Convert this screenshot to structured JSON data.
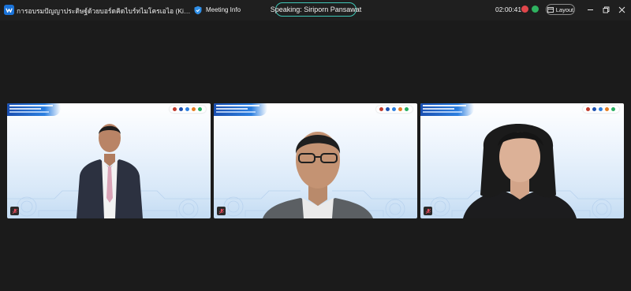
{
  "window": {
    "title": "การอบรมปัญญาประดิษฐ์ด้วยบอร์ดคิดไบร์ทไมโครเอไอ (KidBright μAI) ระหว่างวัน...",
    "meeting_info_label": "Meeting Info",
    "speaking_label": "Speaking: Siriporn Pansawat",
    "timer": "02:00:41",
    "layout_label": "Layout"
  },
  "colors": {
    "background": "#1b1b1b",
    "speaking_border": "#3fc6b6",
    "status_red": "#e0464b",
    "status_green": "#2fb260",
    "banner_blue": "#1a4fb0"
  },
  "participants": [
    {
      "id": "p1",
      "muted": true
    },
    {
      "id": "p2",
      "muted": true
    },
    {
      "id": "p3",
      "muted": true
    }
  ]
}
